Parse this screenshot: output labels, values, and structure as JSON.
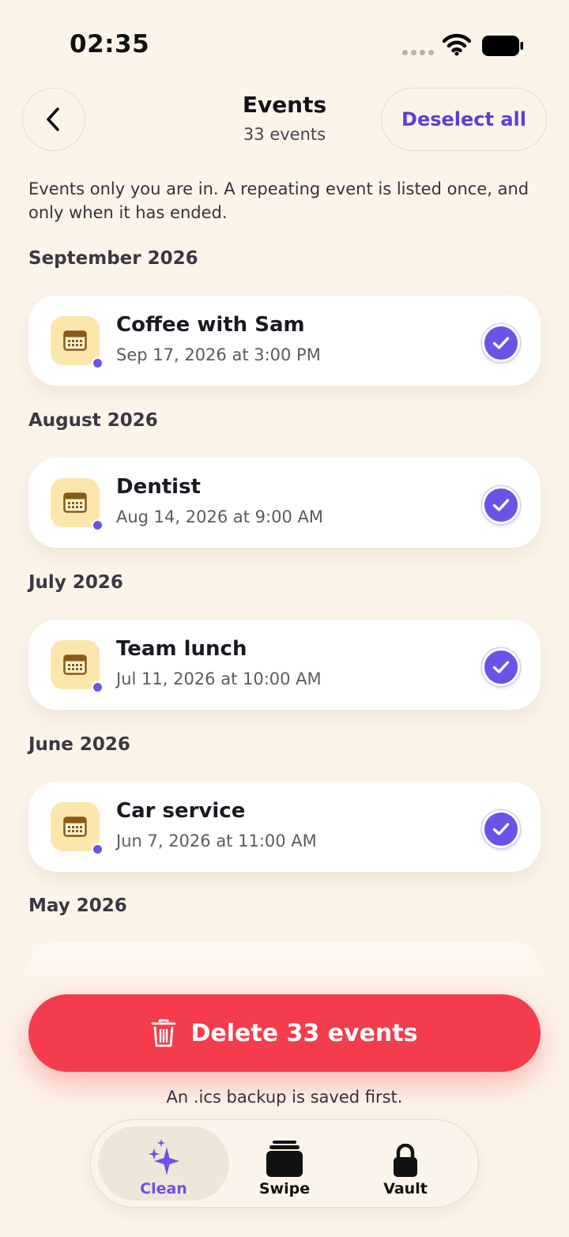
{
  "status_bar": {
    "time": "02:35"
  },
  "header": {
    "title": "Events",
    "subtitle": "33 events",
    "deselect_label": "Deselect all"
  },
  "intro": "Events only you are in. A repeating event is listed once, and only when it has ended.",
  "sections": [
    {
      "month": "September 2026",
      "events": [
        {
          "title": "Coffee with Sam",
          "date": "Sep 17, 2026 at 3:00 PM",
          "selected": true
        }
      ]
    },
    {
      "month": "August 2026",
      "events": [
        {
          "title": "Dentist",
          "date": "Aug 14, 2026 at 9:00 AM",
          "selected": true
        }
      ]
    },
    {
      "month": "July 2026",
      "events": [
        {
          "title": "Team lunch",
          "date": "Jul 11, 2026 at 10:00 AM",
          "selected": true
        }
      ]
    },
    {
      "month": "June 2026",
      "events": [
        {
          "title": "Car service",
          "date": "Jun 7, 2026 at 11:00 AM",
          "selected": true
        }
      ]
    },
    {
      "month": "May 2026",
      "events": []
    }
  ],
  "delete_button": {
    "label": "Delete 33 events"
  },
  "backup_note": "An .ics backup is saved first.",
  "tabbar": {
    "tabs": [
      {
        "label": "Clean",
        "icon": "sparkles-icon",
        "active": true
      },
      {
        "label": "Swipe",
        "icon": "cards-stack-icon",
        "active": false
      },
      {
        "label": "Vault",
        "icon": "lock-icon",
        "active": false
      }
    ]
  },
  "colors": {
    "background": "#fcf4e9",
    "accent": "#6c52e6",
    "destructive": "#f43c4d",
    "calendar_tile": "#fbe7ac"
  }
}
